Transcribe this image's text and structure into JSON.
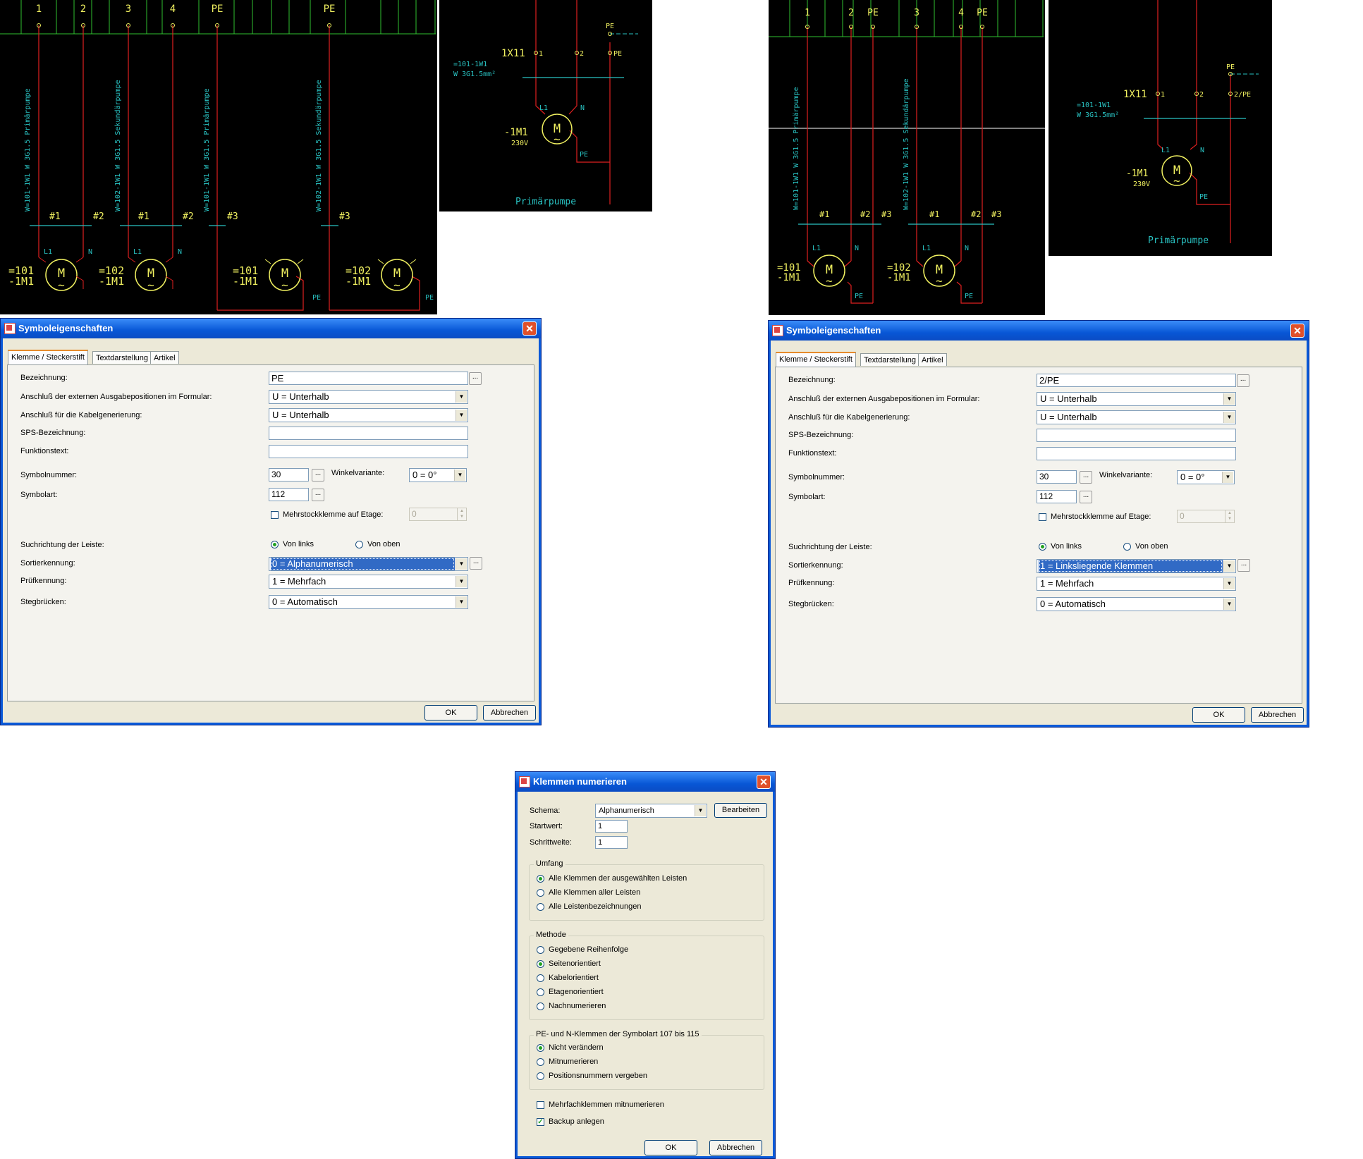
{
  "schematic_left": {
    "terminals": [
      "1",
      "2",
      "3",
      "4",
      "PE",
      "PE"
    ],
    "cables": [
      "W=101-1W1  W 3G1.5  Primärpumpe",
      "W=102-1W1  W 3G1.5  Sekundärpumpe",
      "W=101-1W1  W 3G1.5  Primärpumpe",
      "W=102-1W1  W 3G1.5  Sekundärpumpe"
    ],
    "cores": [
      "#1",
      "#2",
      "#1",
      "#2",
      "#3",
      "#3"
    ],
    "motors": [
      {
        "ref1": "=101",
        "ref2": "-1M1"
      },
      {
        "ref1": "=102",
        "ref2": "-1M1"
      },
      {
        "ref1": "=101",
        "ref2": "-1M1"
      },
      {
        "ref1": "=102",
        "ref2": "-1M1"
      }
    ],
    "m": "M",
    "tilde": "~",
    "l1": "L1",
    "n": "N",
    "pe": "PE"
  },
  "schematic_left_detail": {
    "strip": "1X11",
    "pins": [
      "1",
      "2",
      "PE"
    ],
    "top_pe": "PE",
    "cable1": "=101-1W1",
    "cable2": "W 3G1.5mm²",
    "l1": "L1",
    "n": "N",
    "pe": "PE",
    "motor_ref": "-1M1",
    "voltage": "230V",
    "m": "M",
    "tilde": "~",
    "title": "Primärpumpe"
  },
  "schematic_right": {
    "terminals": [
      "1",
      "2",
      "PE",
      "3",
      "4",
      "PE"
    ],
    "cables": [
      "W=101-1W1  W 3G1.5  Primärpumpe",
      "W=102-1W1  W 3G1.5  Sekundärpumpe"
    ],
    "cores": [
      "#1",
      "#2",
      "#3",
      "#1",
      "#2",
      "#3"
    ],
    "motors": [
      {
        "ref1": "=101",
        "ref2": "-1M1"
      },
      {
        "ref1": "=102",
        "ref2": "-1M1"
      }
    ],
    "m": "M",
    "tilde": "~",
    "l1": "L1",
    "n": "N",
    "pe": "PE"
  },
  "schematic_right_detail": {
    "strip": "1X11",
    "pins": [
      "1",
      "2",
      "2/PE"
    ],
    "top_pe": "PE",
    "cable1": "=101-1W1",
    "cable2": "W 3G1.5mm²",
    "l1": "L1",
    "n": "N",
    "pe": "PE",
    "motor_ref": "-1M1",
    "voltage": "230V",
    "m": "M",
    "tilde": "~",
    "title": "Primärpumpe"
  },
  "dialog_left": {
    "title": "Symboleigenschaften",
    "tabs": [
      "Klemme / Steckerstift",
      "Textdarstellung",
      "Artikel"
    ],
    "labels": {
      "bezeichnung": "Bezeichnung:",
      "anschluss_formular": "Anschluß der externen Ausgabepositionen im Formular:",
      "anschluss_kabel": "Anschluß für die Kabelgenerierung:",
      "sps": "SPS-Bezeichnung:",
      "funktionstext": "Funktionstext:",
      "symbolnummer": "Symbolnummer:",
      "winkelvariante": "Winkelvariante:",
      "symbolart": "Symbolart:",
      "mehrstock": "Mehrstockklemme auf Etage:",
      "suchrichtung": "Suchrichtung der Leiste:",
      "von_links": "Von links",
      "von_oben": "Von oben",
      "sortierkennung": "Sortierkennung:",
      "pruefkennung": "Prüfkennung:",
      "stegbruecken": "Stegbrücken:"
    },
    "values": {
      "bezeichnung": "PE",
      "anschluss_formular": "U = Unterhalb",
      "anschluss_kabel": "U = Unterhalb",
      "sps": "",
      "funktionstext": "",
      "symbolnummer": "30",
      "winkelvariante": "0 = 0°",
      "symbolart": "112",
      "etage": "0",
      "sortierkennung": "0 = Alphanumerisch",
      "pruefkennung": "1 = Mehrfach",
      "stegbruecken": "0 = Automatisch"
    },
    "dots": "...",
    "ok": "OK",
    "cancel": "Abbrechen"
  },
  "dialog_right": {
    "title": "Symboleigenschaften",
    "tabs": [
      "Klemme / Steckerstift",
      "Textdarstellung",
      "Artikel"
    ],
    "labels": {
      "bezeichnung": "Bezeichnung:",
      "anschluss_formular": "Anschluß der externen Ausgabepositionen im Formular:",
      "anschluss_kabel": "Anschluß für die Kabelgenerierung:",
      "sps": "SPS-Bezeichnung:",
      "funktionstext": "Funktionstext:",
      "symbolnummer": "Symbolnummer:",
      "winkelvariante": "Winkelvariante:",
      "symbolart": "Symbolart:",
      "mehrstock": "Mehrstockklemme auf Etage:",
      "suchrichtung": "Suchrichtung der Leiste:",
      "von_links": "Von links",
      "von_oben": "Von oben",
      "sortierkennung": "Sortierkennung:",
      "pruefkennung": "Prüfkennung:",
      "stegbruecken": "Stegbrücken:"
    },
    "values": {
      "bezeichnung": "2/PE",
      "anschluss_formular": "U = Unterhalb",
      "anschluss_kabel": "U = Unterhalb",
      "sps": "",
      "funktionstext": "",
      "symbolnummer": "30",
      "winkelvariante": "0 = 0°",
      "symbolart": "112",
      "etage": "0",
      "sortierkennung": "1 = Linksliegende Klemmen",
      "pruefkennung": "1 = Mehrfach",
      "stegbruecken": "0 = Automatisch"
    },
    "dots": "...",
    "ok": "OK",
    "cancel": "Abbrechen"
  },
  "dialog_bottom": {
    "title": "Klemmen numerieren",
    "schema_label": "Schema:",
    "schema_value": "Alphanumerisch",
    "edit": "Bearbeiten",
    "startwert_label": "Startwert:",
    "startwert": "1",
    "schrittweite_label": "Schrittweite:",
    "schrittweite": "1",
    "umfang": {
      "title": "Umfang",
      "options": [
        "Alle Klemmen der ausgewählten Leisten",
        "Alle Klemmen aller Leisten",
        "Alle Leistenbezeichnungen"
      ],
      "selected": 0
    },
    "methode": {
      "title": "Methode",
      "options": [
        "Gegebene Reihenfolge",
        "Seitenorientiert",
        "Kabelorientiert",
        "Etagenorientiert",
        "Nachnumerieren"
      ],
      "selected": 1
    },
    "pe_n": {
      "title": "PE- und N-Klemmen der Symbolart 107 bis 115",
      "options": [
        "Nicht verändern",
        "Mitnumerieren",
        "Positionsnummern vergeben"
      ],
      "selected": 0
    },
    "mehrfach": {
      "label": "Mehrfachklemmen mitnumerieren",
      "checked": false
    },
    "backup": {
      "label": "Backup anlegen",
      "checked": true
    },
    "ok": "OK",
    "cancel": "Abbrechen"
  },
  "colors": {
    "cad_bg": "#000000",
    "wire_red": "#e02020",
    "label_yellow": "#f0f060",
    "cable_cyan": "#29c2c2",
    "grid_green": "#30c030",
    "xp_blue": "#0a59d8",
    "dialog_face": "#ece9d8",
    "selection_blue": "#316ac5"
  }
}
